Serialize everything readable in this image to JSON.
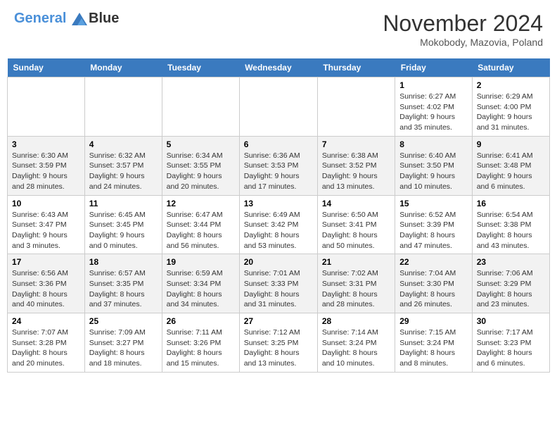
{
  "logo": {
    "line1": "General",
    "line2": "Blue"
  },
  "title": "November 2024",
  "location": "Mokobody, Mazovia, Poland",
  "weekdays": [
    "Sunday",
    "Monday",
    "Tuesday",
    "Wednesday",
    "Thursday",
    "Friday",
    "Saturday"
  ],
  "weeks": [
    [
      {
        "day": "",
        "info": ""
      },
      {
        "day": "",
        "info": ""
      },
      {
        "day": "",
        "info": ""
      },
      {
        "day": "",
        "info": ""
      },
      {
        "day": "",
        "info": ""
      },
      {
        "day": "1",
        "info": "Sunrise: 6:27 AM\nSunset: 4:02 PM\nDaylight: 9 hours and 35 minutes."
      },
      {
        "day": "2",
        "info": "Sunrise: 6:29 AM\nSunset: 4:00 PM\nDaylight: 9 hours and 31 minutes."
      }
    ],
    [
      {
        "day": "3",
        "info": "Sunrise: 6:30 AM\nSunset: 3:59 PM\nDaylight: 9 hours and 28 minutes."
      },
      {
        "day": "4",
        "info": "Sunrise: 6:32 AM\nSunset: 3:57 PM\nDaylight: 9 hours and 24 minutes."
      },
      {
        "day": "5",
        "info": "Sunrise: 6:34 AM\nSunset: 3:55 PM\nDaylight: 9 hours and 20 minutes."
      },
      {
        "day": "6",
        "info": "Sunrise: 6:36 AM\nSunset: 3:53 PM\nDaylight: 9 hours and 17 minutes."
      },
      {
        "day": "7",
        "info": "Sunrise: 6:38 AM\nSunset: 3:52 PM\nDaylight: 9 hours and 13 minutes."
      },
      {
        "day": "8",
        "info": "Sunrise: 6:40 AM\nSunset: 3:50 PM\nDaylight: 9 hours and 10 minutes."
      },
      {
        "day": "9",
        "info": "Sunrise: 6:41 AM\nSunset: 3:48 PM\nDaylight: 9 hours and 6 minutes."
      }
    ],
    [
      {
        "day": "10",
        "info": "Sunrise: 6:43 AM\nSunset: 3:47 PM\nDaylight: 9 hours and 3 minutes."
      },
      {
        "day": "11",
        "info": "Sunrise: 6:45 AM\nSunset: 3:45 PM\nDaylight: 9 hours and 0 minutes."
      },
      {
        "day": "12",
        "info": "Sunrise: 6:47 AM\nSunset: 3:44 PM\nDaylight: 8 hours and 56 minutes."
      },
      {
        "day": "13",
        "info": "Sunrise: 6:49 AM\nSunset: 3:42 PM\nDaylight: 8 hours and 53 minutes."
      },
      {
        "day": "14",
        "info": "Sunrise: 6:50 AM\nSunset: 3:41 PM\nDaylight: 8 hours and 50 minutes."
      },
      {
        "day": "15",
        "info": "Sunrise: 6:52 AM\nSunset: 3:39 PM\nDaylight: 8 hours and 47 minutes."
      },
      {
        "day": "16",
        "info": "Sunrise: 6:54 AM\nSunset: 3:38 PM\nDaylight: 8 hours and 43 minutes."
      }
    ],
    [
      {
        "day": "17",
        "info": "Sunrise: 6:56 AM\nSunset: 3:36 PM\nDaylight: 8 hours and 40 minutes."
      },
      {
        "day": "18",
        "info": "Sunrise: 6:57 AM\nSunset: 3:35 PM\nDaylight: 8 hours and 37 minutes."
      },
      {
        "day": "19",
        "info": "Sunrise: 6:59 AM\nSunset: 3:34 PM\nDaylight: 8 hours and 34 minutes."
      },
      {
        "day": "20",
        "info": "Sunrise: 7:01 AM\nSunset: 3:33 PM\nDaylight: 8 hours and 31 minutes."
      },
      {
        "day": "21",
        "info": "Sunrise: 7:02 AM\nSunset: 3:31 PM\nDaylight: 8 hours and 28 minutes."
      },
      {
        "day": "22",
        "info": "Sunrise: 7:04 AM\nSunset: 3:30 PM\nDaylight: 8 hours and 26 minutes."
      },
      {
        "day": "23",
        "info": "Sunrise: 7:06 AM\nSunset: 3:29 PM\nDaylight: 8 hours and 23 minutes."
      }
    ],
    [
      {
        "day": "24",
        "info": "Sunrise: 7:07 AM\nSunset: 3:28 PM\nDaylight: 8 hours and 20 minutes."
      },
      {
        "day": "25",
        "info": "Sunrise: 7:09 AM\nSunset: 3:27 PM\nDaylight: 8 hours and 18 minutes."
      },
      {
        "day": "26",
        "info": "Sunrise: 7:11 AM\nSunset: 3:26 PM\nDaylight: 8 hours and 15 minutes."
      },
      {
        "day": "27",
        "info": "Sunrise: 7:12 AM\nSunset: 3:25 PM\nDaylight: 8 hours and 13 minutes."
      },
      {
        "day": "28",
        "info": "Sunrise: 7:14 AM\nSunset: 3:24 PM\nDaylight: 8 hours and 10 minutes."
      },
      {
        "day": "29",
        "info": "Sunrise: 7:15 AM\nSunset: 3:24 PM\nDaylight: 8 hours and 8 minutes."
      },
      {
        "day": "30",
        "info": "Sunrise: 7:17 AM\nSunset: 3:23 PM\nDaylight: 8 hours and 6 minutes."
      }
    ]
  ]
}
